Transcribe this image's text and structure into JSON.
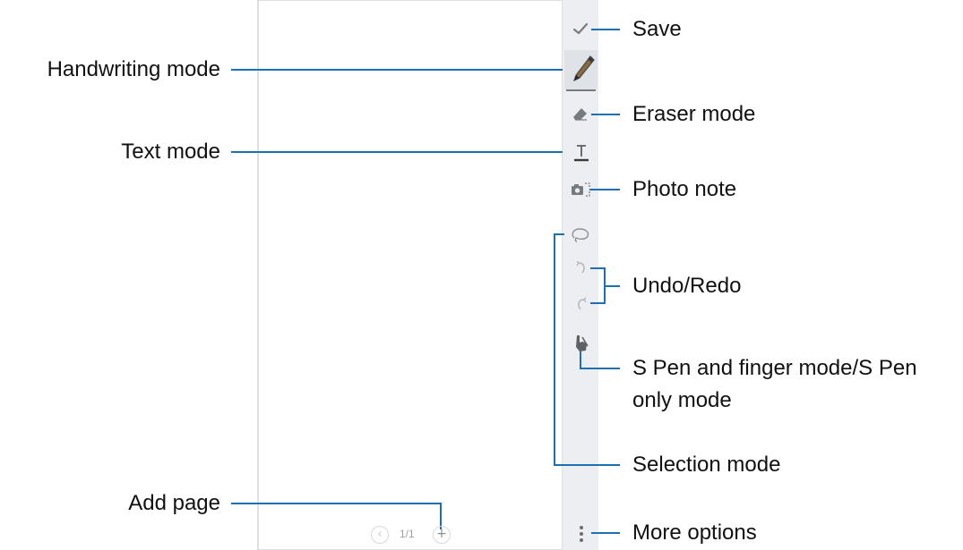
{
  "toolbar": {
    "icons": [
      "check-icon",
      "pen-icon",
      "eraser-icon",
      "text-icon",
      "camera-icon",
      "lasso-icon",
      "undo-icon",
      "redo-icon",
      "hand-pen-icon",
      "more-vertical-icon"
    ]
  },
  "canvas": {
    "page_indicator": "1/1",
    "prev_symbol": "‹",
    "add_symbol": "+"
  },
  "labels": {
    "handwriting_mode": "Handwriting mode",
    "text_mode": "Text mode",
    "add_page": "Add page",
    "save": "Save",
    "eraser_mode": "Eraser mode",
    "photo_note": "Photo note",
    "undo_redo": "Undo/Redo",
    "spen_mode_line1": "S Pen and finger mode/S Pen",
    "spen_mode_line2": "only mode",
    "selection_mode": "Selection mode",
    "more_options": "More options"
  },
  "colors": {
    "callout_line": "#1d6fb3",
    "toolbar_bg": "#eceef1",
    "canvas_border": "#d3d6da",
    "icon": "#777b80"
  }
}
